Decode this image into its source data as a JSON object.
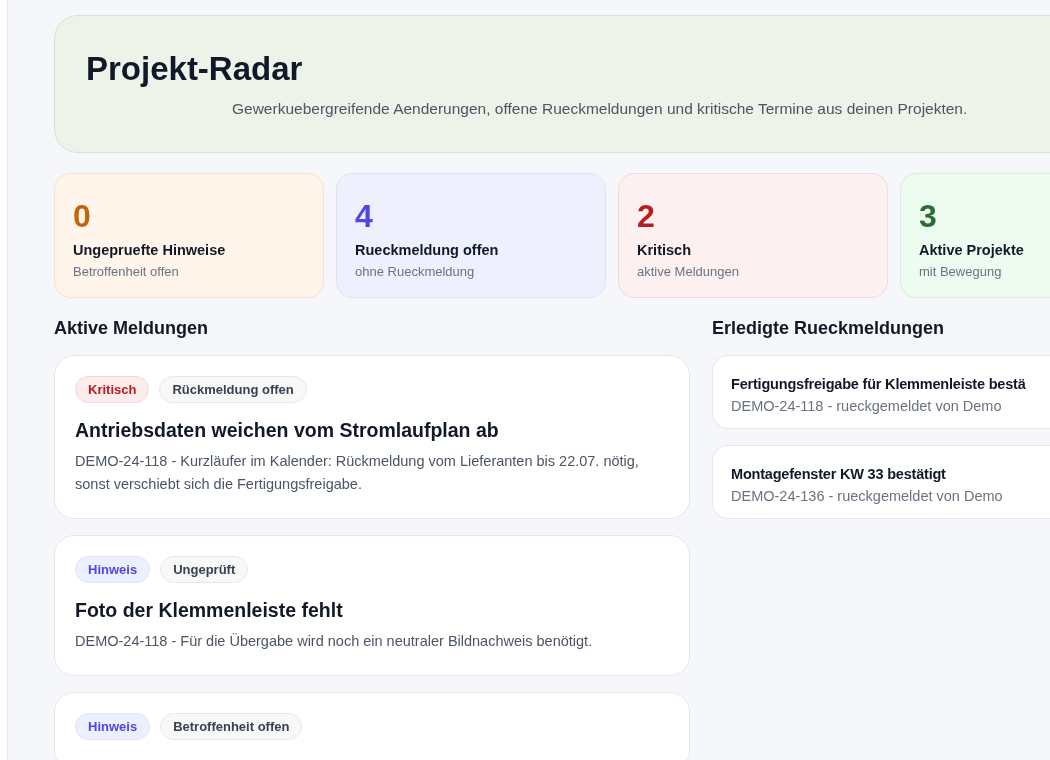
{
  "header": {
    "title": "Projekt-Radar",
    "subtitle": "Gewerkuebergreifende Aenderungen, offene Rueckmeldungen und kritische Termine aus deinen Projekten."
  },
  "stats": [
    {
      "value": "0",
      "label": "Ungepruefte Hinweise",
      "note": "Betroffenheit offen",
      "color": "#c2650a"
    },
    {
      "value": "4",
      "label": "Rueckmeldung offen",
      "note": "ohne Rueckmeldung",
      "color": "#4f46e5"
    },
    {
      "value": "2",
      "label": "Kritisch",
      "note": "aktive Meldungen",
      "color": "#b91c1c"
    },
    {
      "value": "3",
      "label": "Aktive Projekte",
      "note": "mit Bewegung",
      "color": "#2f6b35"
    }
  ],
  "active": {
    "heading": "Aktive Meldungen",
    "items": [
      {
        "tags": [
          {
            "kind": "critical",
            "label": "Kritisch"
          },
          {
            "kind": "neutral",
            "label": "Rückmeldung offen"
          }
        ],
        "title": "Antriebsdaten weichen vom Stromlaufplan ab",
        "text": "DEMO-24-118 - Kurzläufer im Kalender: Rückmeldung vom Lieferanten bis 22.07. nötig, sonst verschiebt sich die Fertigungsfreigabe."
      },
      {
        "tags": [
          {
            "kind": "hint",
            "label": "Hinweis"
          },
          {
            "kind": "neutral",
            "label": "Ungeprüft"
          }
        ],
        "title": "Foto der Klemmenleiste fehlt",
        "text": "DEMO-24-118 - Für die Übergabe wird noch ein neutraler Bildnachweis benötigt."
      },
      {
        "tags": [
          {
            "kind": "hint",
            "label": "Hinweis"
          },
          {
            "kind": "neutral",
            "label": "Betroffenheit offen"
          }
        ]
      }
    ]
  },
  "done": {
    "heading": "Erledigte Rueckmeldungen",
    "items": [
      {
        "title": "Fertigungsfreigabe für Klemmenleiste bestä",
        "text": "DEMO-24-118 - rueckgemeldet von Demo"
      },
      {
        "title": "Montagefenster KW 33 bestätigt",
        "text": "DEMO-24-136 - rueckgemeldet von Demo"
      }
    ]
  }
}
